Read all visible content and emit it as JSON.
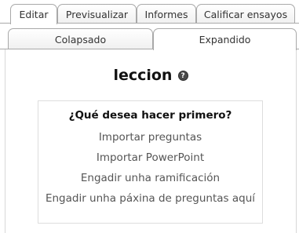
{
  "tabs_row1": [
    {
      "label": "Editar",
      "active": true
    },
    {
      "label": "Previsualizar",
      "active": false
    },
    {
      "label": "Informes",
      "active": false
    },
    {
      "label": "Calificar ensayos",
      "active": false
    }
  ],
  "tabs_row2": [
    {
      "label": "Colapsado",
      "active": false
    },
    {
      "label": "Expandido",
      "active": true
    }
  ],
  "page": {
    "title": "leccion",
    "help_icon": "question-mark-icon",
    "help_glyph": "?"
  },
  "choices": {
    "question": "¿Qué desea hacer primero?",
    "options": [
      "Importar preguntas",
      "Importar PowerPoint",
      "Engadir unha ramificación",
      "Engadir unha páxina de preguntas aquí"
    ]
  },
  "colors": {
    "tab_border": "#a9a9a9",
    "link_text": "#555555",
    "title_text": "#111111"
  }
}
